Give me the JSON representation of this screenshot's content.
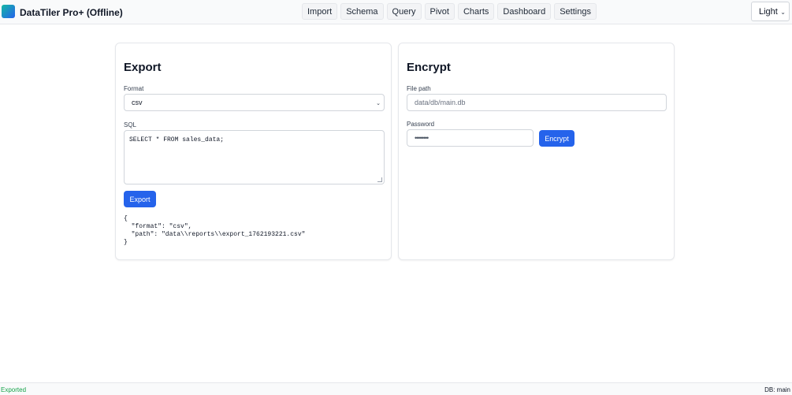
{
  "app": {
    "title": "DataTiler Pro+ (Offline)",
    "logo_icon": "app-logo-icon",
    "accent_color": "#2563eb"
  },
  "nav": {
    "items": [
      "Import",
      "Schema",
      "Query",
      "Pivot",
      "Charts",
      "Dashboard",
      "Settings"
    ]
  },
  "theme": {
    "selected": "Light"
  },
  "export_card": {
    "title": "Export",
    "format_label": "Format",
    "format_value": "csv",
    "sql_label": "SQL",
    "sql_value": "SELECT * FROM sales_data;",
    "button_label": "Export",
    "output_lines": [
      "{",
      "  \"format\": \"csv\",",
      "  \"path\": \"data\\\\reports\\\\export_1762193221.csv\"",
      "}"
    ]
  },
  "encrypt_card": {
    "title": "Encrypt",
    "file_path_label": "File path",
    "file_path_placeholder": "data/db/main.db",
    "password_label": "Password",
    "password_value": "••••••••",
    "button_label": "Encrypt"
  },
  "status": {
    "left": "Exported",
    "right": "DB: main",
    "left_color": "#16a34a"
  }
}
